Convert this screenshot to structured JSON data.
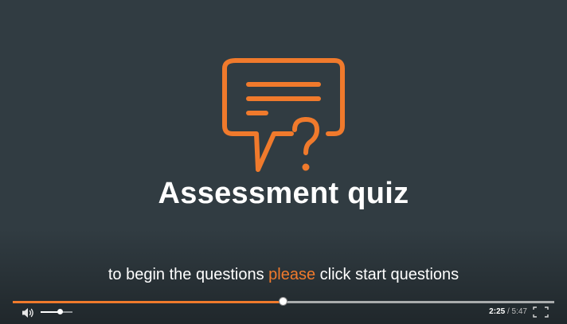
{
  "slide": {
    "title": "Assessment quiz",
    "subtitle_before": "to begin the questions ",
    "subtitle_highlight": "please",
    "subtitle_after": " click start questions",
    "icon": "speech-bubble-question-icon"
  },
  "player": {
    "current_time": "2:25",
    "separator": "/",
    "total_time": "5:47",
    "progress_fraction": 0.5,
    "volume_fraction": 0.6,
    "volume_icon": "speaker-icon",
    "fullscreen_icon": "fullscreen-icon"
  },
  "colors": {
    "accent": "#f07a2c",
    "background": "#313c42",
    "text": "#ffffff"
  }
}
